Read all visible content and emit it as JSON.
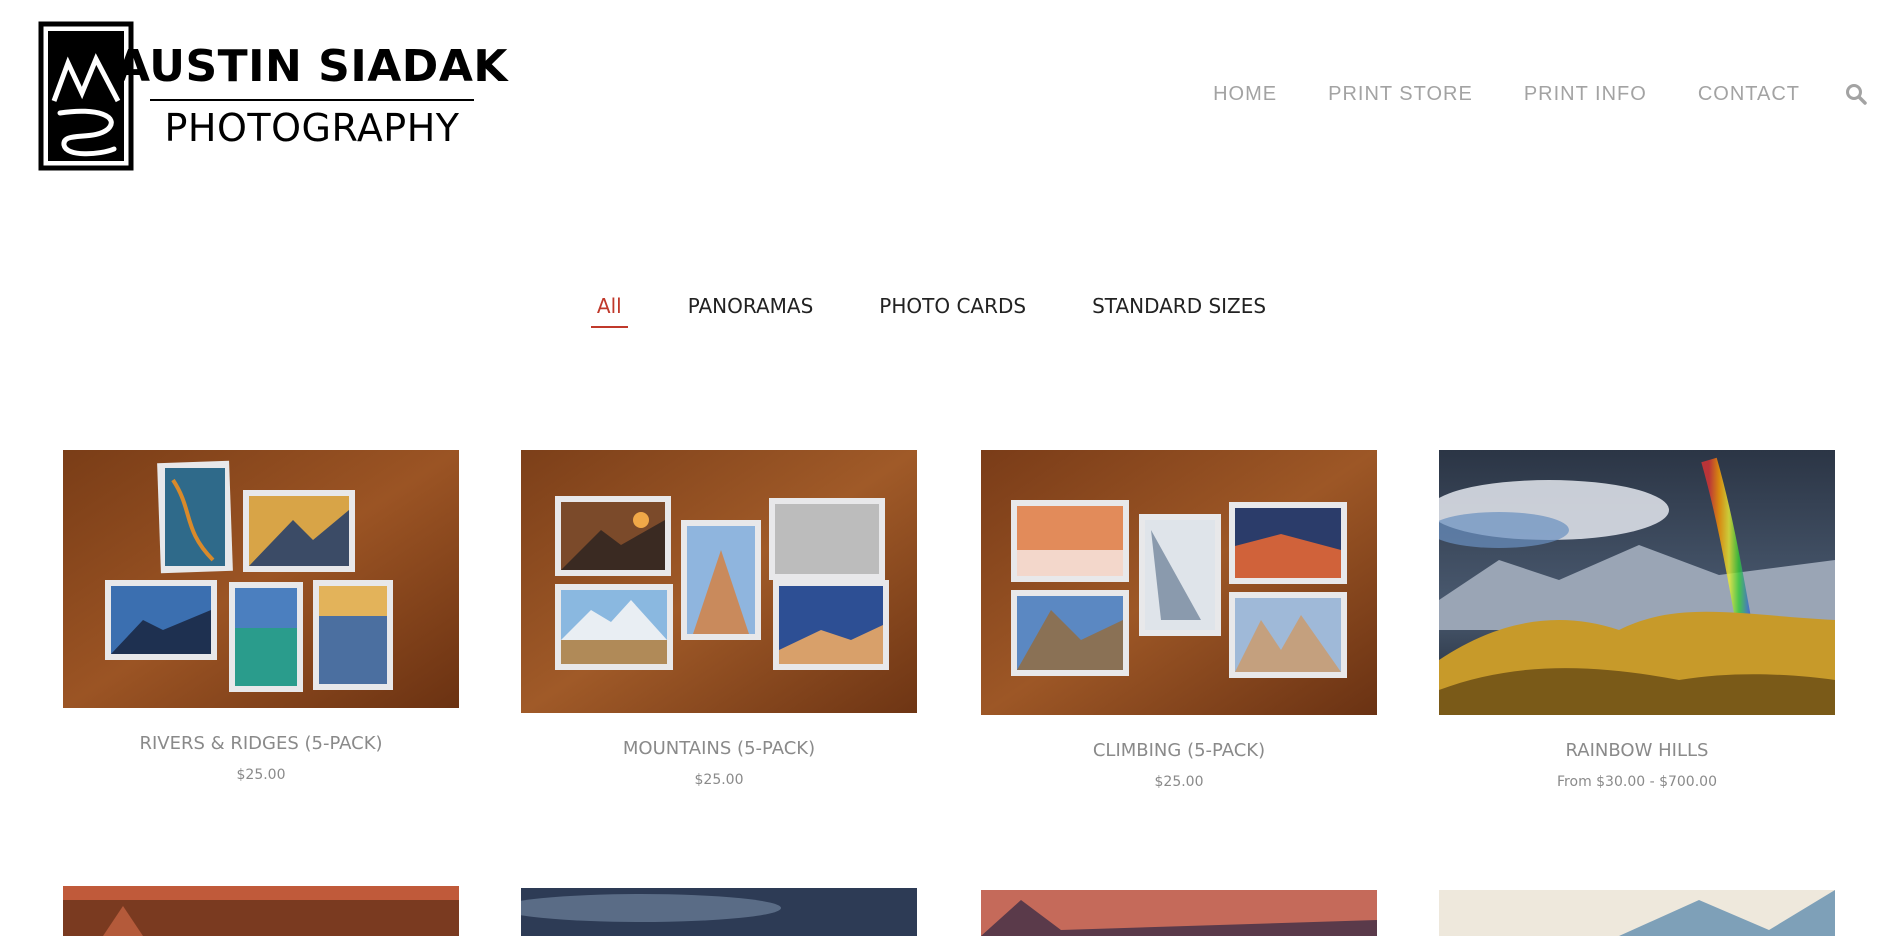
{
  "brand": {
    "name": "AUSTIN SIADAK",
    "subtitle": "PHOTOGRAPHY"
  },
  "nav": {
    "items": [
      "HOME",
      "PRINT STORE",
      "PRINT INFO",
      "CONTACT"
    ],
    "search_icon": "search-icon"
  },
  "filters": {
    "items": [
      "All",
      "PANORAMAS",
      "PHOTO CARDS",
      "STANDARD SIZES"
    ],
    "active": "All"
  },
  "products": [
    {
      "title": "RIVERS & RIDGES (5-PACK)",
      "price": "$25.00"
    },
    {
      "title": "MOUNTAINS (5-PACK)",
      "price": "$25.00"
    },
    {
      "title": "CLIMBING (5-PACK)",
      "price": "$25.00"
    },
    {
      "title": "RAINBOW HILLS",
      "price": "From $30.00 - $700.00"
    }
  ],
  "colors": {
    "accent": "#c0392b",
    "nav_text": "#a3a3a3",
    "product_text": "#8a8a8a"
  }
}
